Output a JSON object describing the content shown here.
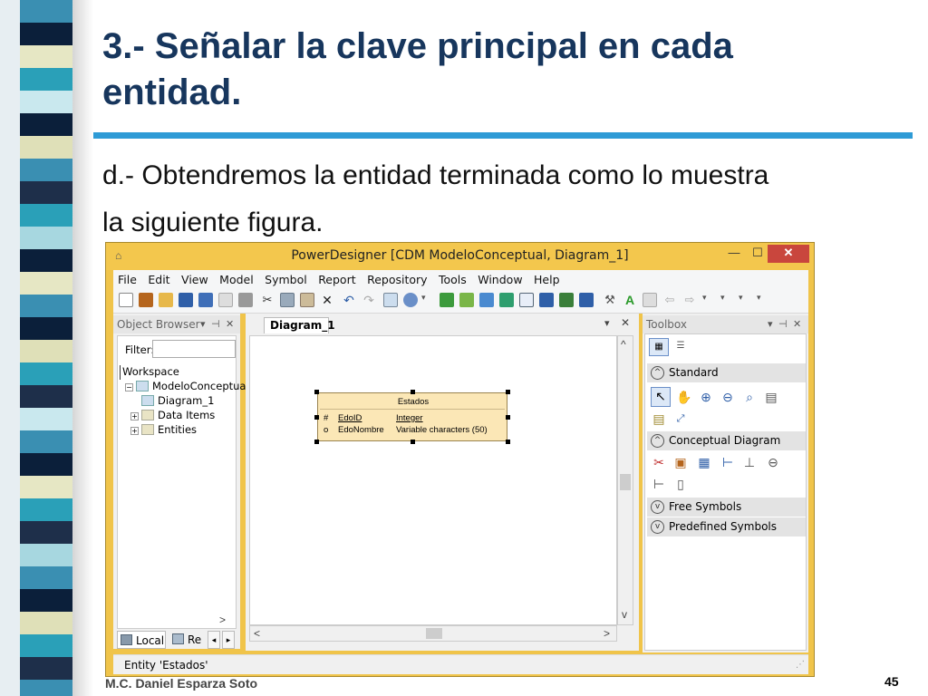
{
  "slide": {
    "title_line1": "3.- Señalar la clave principal en cada",
    "title_line2": "entidad.",
    "subtitle_line1": "d.- Obtendremos la entidad terminada como lo muestra",
    "subtitle_line2": "la siguiente figura.",
    "footer_author": "M.C. Daniel Esparza Soto",
    "page_number": "45",
    "accent_color": "#2e9bd6",
    "title_color": "#17365d"
  },
  "window": {
    "title": "PowerDesigner [CDM ModeloConceptual, Diagram_1]",
    "minimize_icon": "minimize-icon",
    "maximize_icon": "maximize-icon",
    "close_label": "✕",
    "frame_color": "#f0c44a"
  },
  "menu": {
    "items": [
      "File",
      "Edit",
      "View",
      "Model",
      "Symbol",
      "Report",
      "Repository",
      "Tools",
      "Window",
      "Help"
    ]
  },
  "object_browser": {
    "header": "Object Browser",
    "filter_label": "Filter:",
    "filter_value": "",
    "tree": {
      "workspace": "Workspace",
      "model": "ModeloConceptual *",
      "diagram": "Diagram_1",
      "data_items": "Data Items",
      "entities": "Entities"
    },
    "tab_local": "Local",
    "tab_repo": "Re"
  },
  "diagram": {
    "tab_label": "Diagram_1",
    "entity": {
      "name": "Estados",
      "attributes": [
        {
          "marker": "#",
          "name": "EdoID",
          "type": "Integer"
        },
        {
          "marker": "o",
          "name": "EdoNombre",
          "type": "Variable characters (50)"
        }
      ]
    }
  },
  "toolbox": {
    "header": "Toolbox",
    "sections": {
      "standard": "Standard",
      "conceptual": "Conceptual Diagram",
      "free": "Free Symbols",
      "predefined": "Predefined Symbols"
    }
  },
  "status_bar": {
    "text": "Entity 'Estados'"
  }
}
